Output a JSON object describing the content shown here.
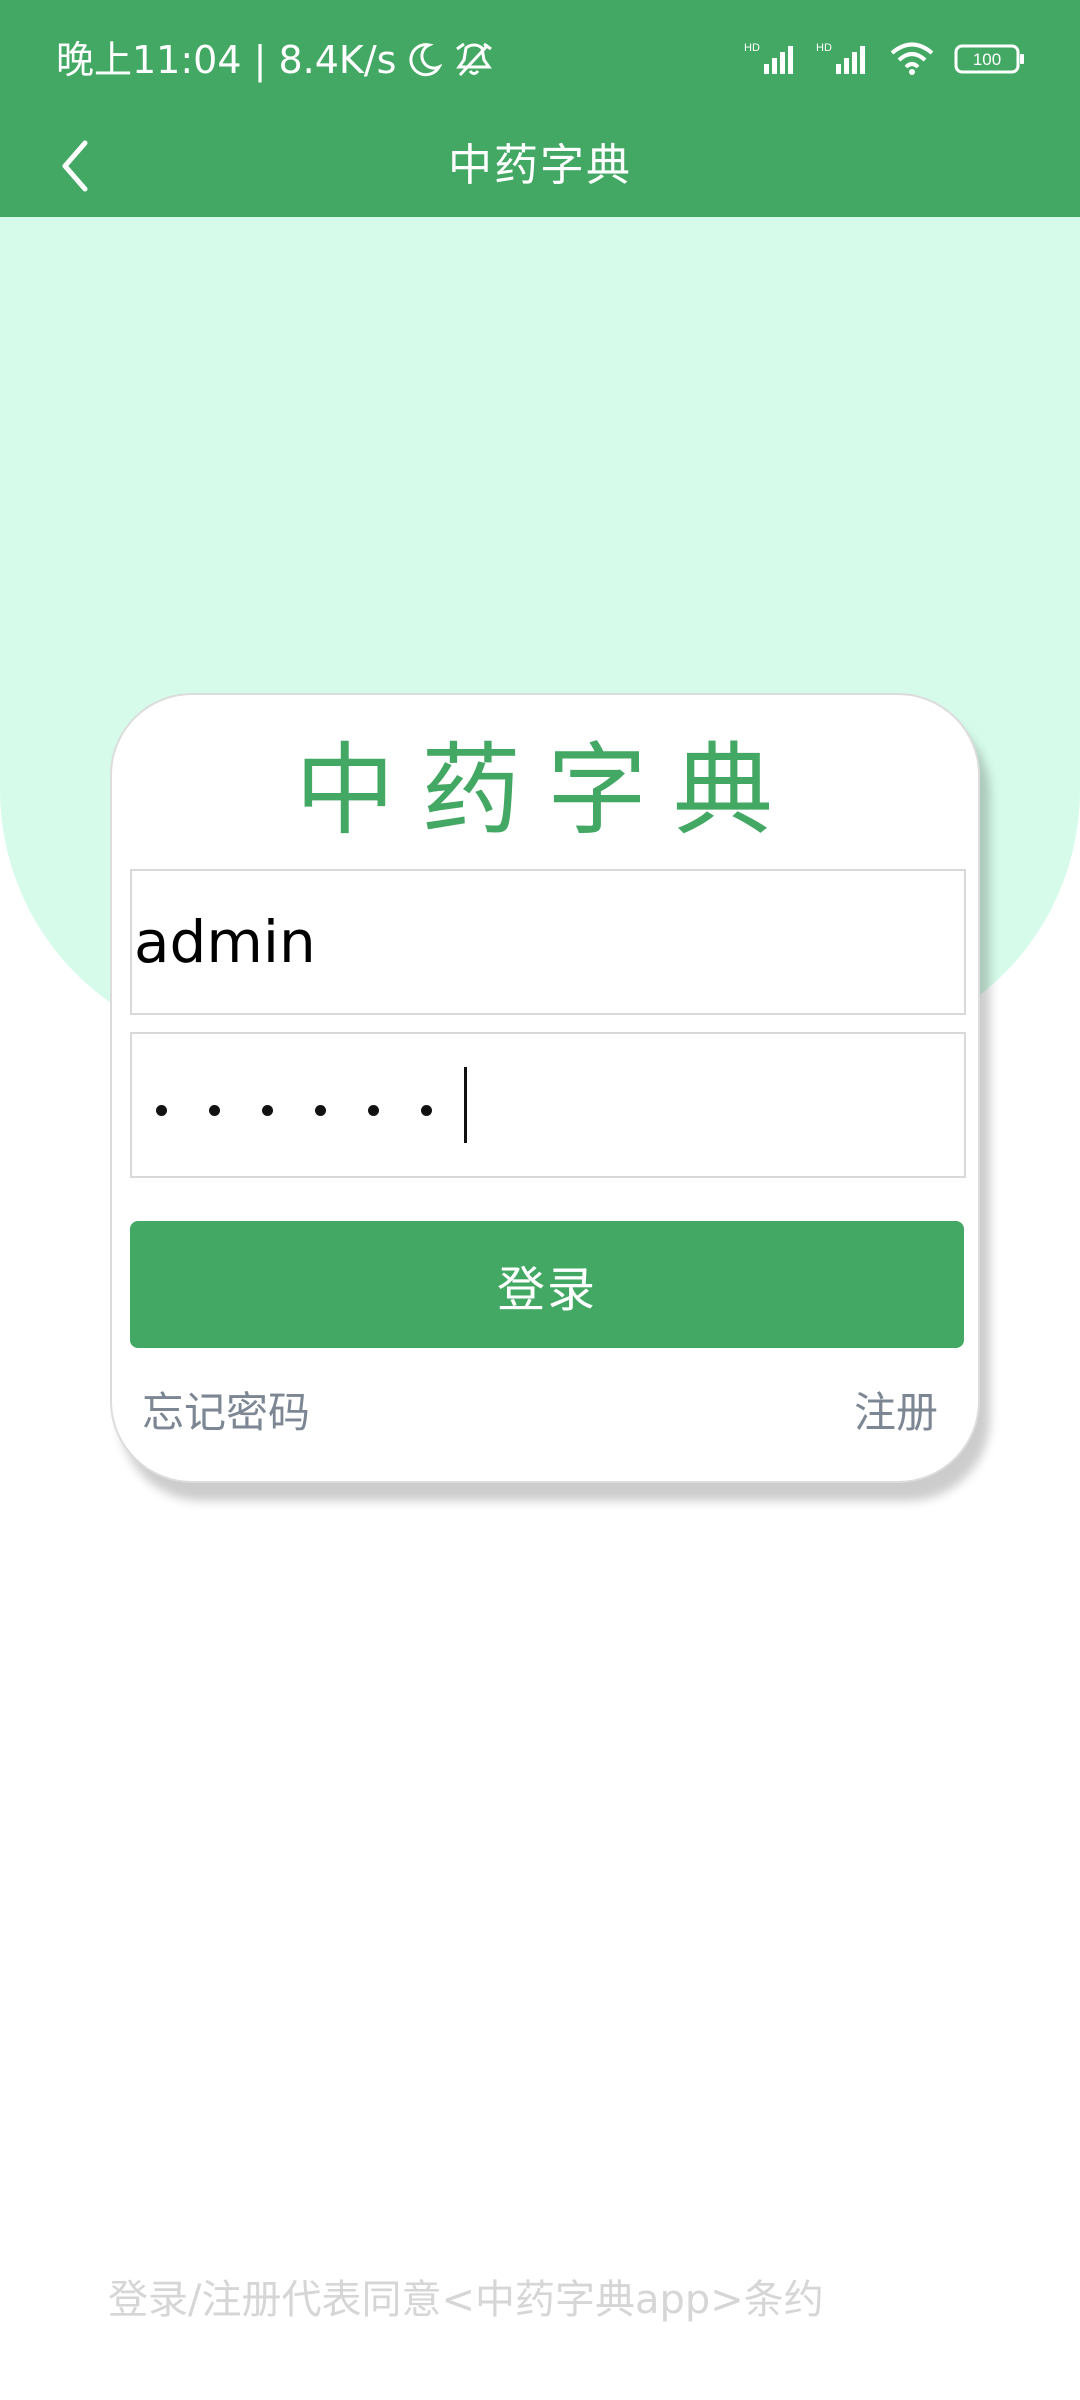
{
  "colors": {
    "primary": "#43a863",
    "mint_background": "#d7fbea",
    "link_gray": "#7d8794",
    "agreement_gray": "#d6d6d6",
    "white": "#ffffff"
  },
  "status_bar": {
    "time_speed": "晚上11:04 | 8.4K/s",
    "icons": [
      "moon-icon",
      "muted-alarm-icon",
      "signal-icon",
      "signal-icon",
      "wifi-icon",
      "battery-icon"
    ],
    "battery_level": "100"
  },
  "header": {
    "back_icon": "back-arrow-icon",
    "title": "中药字典"
  },
  "login": {
    "brand_title": "中药字典",
    "username_value": "admin",
    "password_mask_count": 6,
    "button_label": "登录",
    "forgot_password": "忘记密码",
    "register": "注册"
  },
  "footer": {
    "agreement": "登录/注册代表同意<中药字典app>条约"
  }
}
